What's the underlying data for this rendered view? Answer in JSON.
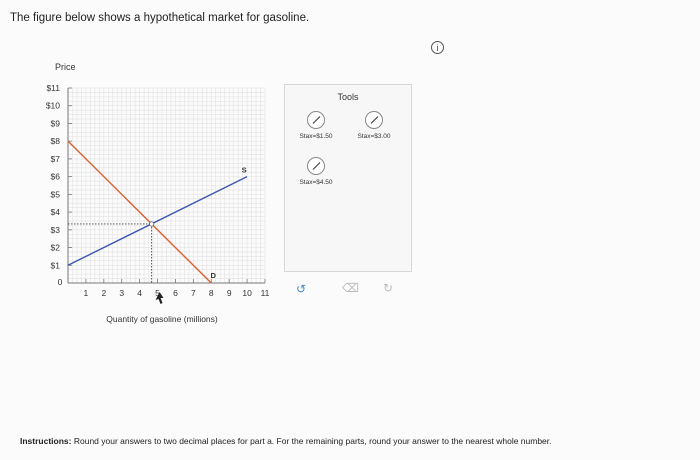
{
  "intro_text": "The figure below shows a hypothetical market for gasoline.",
  "info_icon": "i",
  "tools_panel": {
    "title": "Tools",
    "items": [
      {
        "label": "Stax=$1.50",
        "icon": "line-tool-icon"
      },
      {
        "label": "Stax=$3.00",
        "icon": "line-tool-icon"
      },
      {
        "label": "Stax=$4.50",
        "icon": "line-tool-icon"
      }
    ],
    "actions": {
      "undo": "↺",
      "erase": "⌫",
      "redo": "↻"
    }
  },
  "instructions": {
    "label": "Instructions:",
    "text": " Round your answers to two decimal places for part a. For the remaining parts, round your answer to the nearest whole number."
  },
  "chart_data": {
    "type": "line",
    "ylabel": "Price",
    "xlabel": "Quantity of gasoline (millions)",
    "xlim": [
      0,
      11
    ],
    "ylim": [
      0,
      11
    ],
    "x_ticks": [
      0,
      1,
      2,
      3,
      4,
      5,
      6,
      7,
      8,
      9,
      10,
      11
    ],
    "x_tick_labels": [
      "0",
      "1",
      "2",
      "3",
      "4",
      "5",
      "6",
      "7",
      "8",
      "9",
      "10",
      "11"
    ],
    "y_ticks": [
      1,
      2,
      3,
      4,
      5,
      6,
      7,
      8,
      9,
      10,
      11
    ],
    "y_tick_labels": [
      "$1",
      "$2",
      "$3",
      "$4",
      "$5",
      "$6",
      "$7",
      "$8",
      "$9",
      "$10",
      "$11"
    ],
    "series": [
      {
        "name": "D",
        "color": "#d9602f",
        "points": [
          [
            0,
            8
          ],
          [
            8,
            0
          ]
        ]
      },
      {
        "name": "S",
        "color": "#3d56b2",
        "points": [
          [
            0,
            1
          ],
          [
            10,
            6
          ]
        ]
      }
    ],
    "equilibrium": {
      "x": 4.67,
      "y": 3.33
    },
    "grid": true
  }
}
